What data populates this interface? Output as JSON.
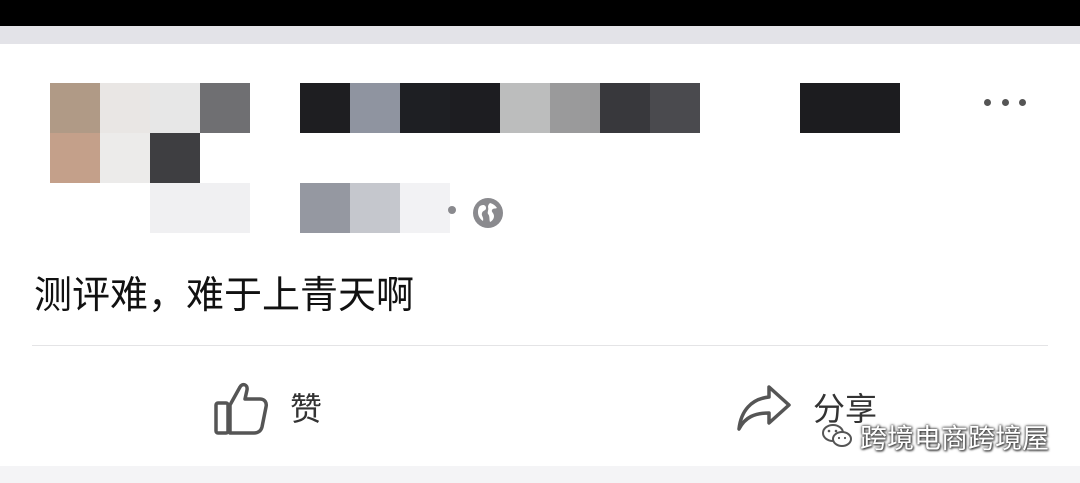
{
  "post": {
    "text": "测评难，难于上青天啊"
  },
  "actions": {
    "like_label": "赞",
    "share_label": "分享"
  },
  "icons": {
    "more": "more-horizontal-icon",
    "privacy": "globe-icon",
    "like": "thumbs-up-icon",
    "share": "share-arrow-icon",
    "watermark": "wechat-icon"
  },
  "watermark": {
    "text": "跨境电商跨境屋"
  },
  "colors": {
    "text_primary": "#111111",
    "action_text": "#333333",
    "icon_gray": "#8a8a8e",
    "divider": "#e4e4e6"
  }
}
